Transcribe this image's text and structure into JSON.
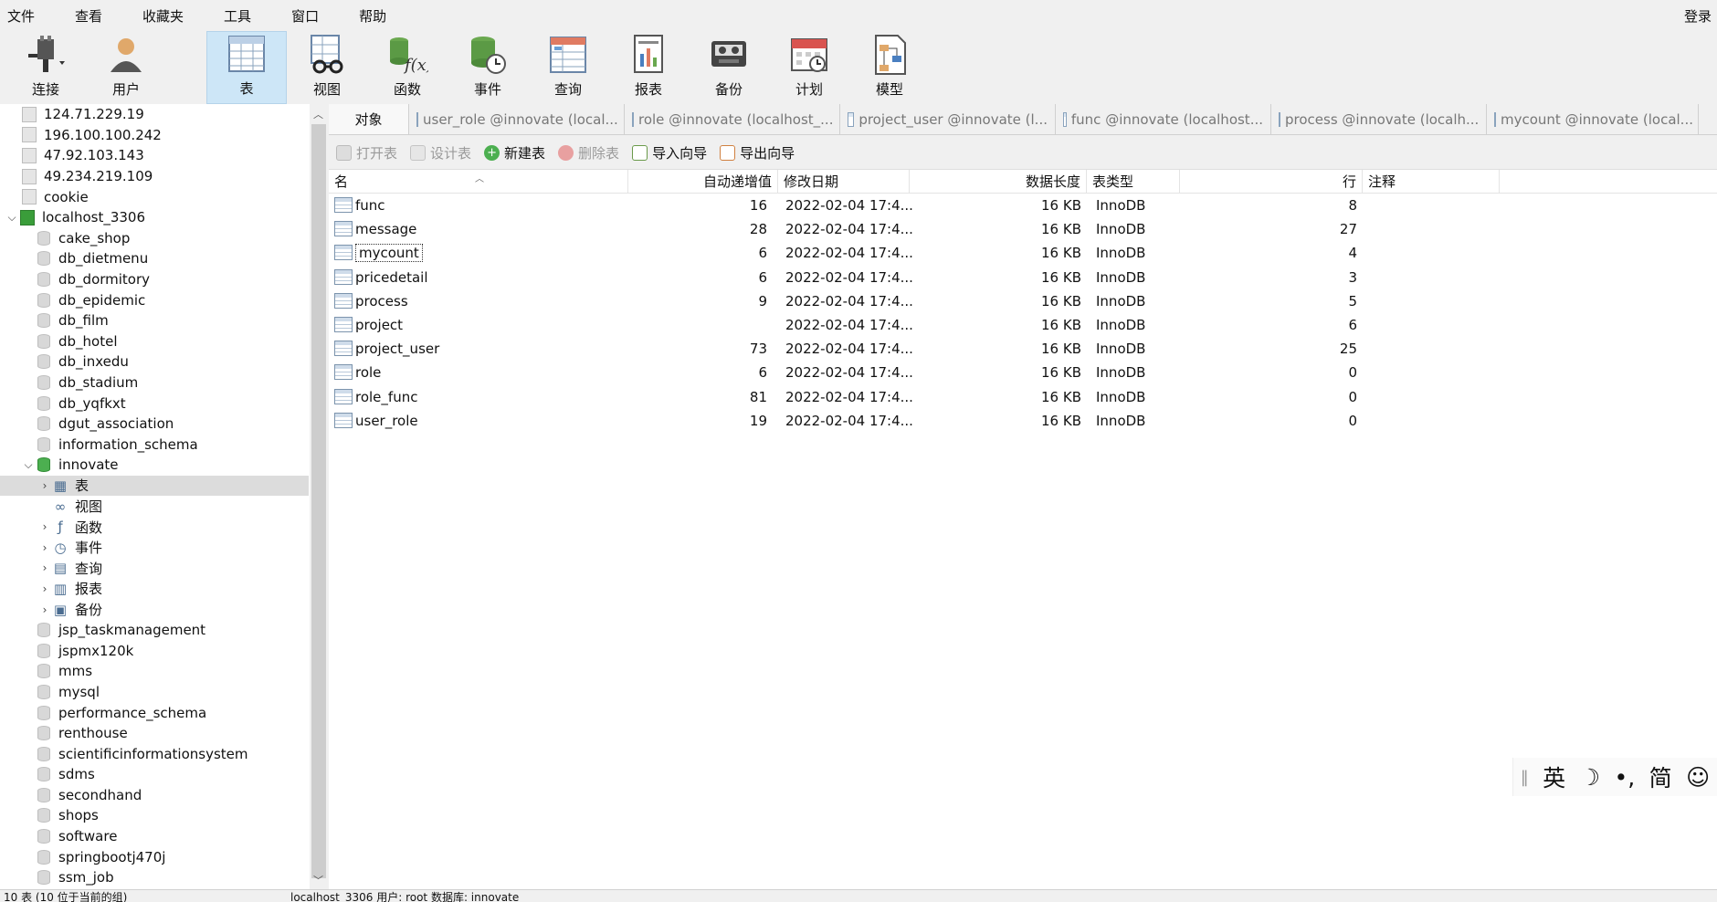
{
  "menu": {
    "items": [
      "文件",
      "查看",
      "收藏夹",
      "工具",
      "窗口",
      "帮助"
    ],
    "login": "登录"
  },
  "toolbar": {
    "items": [
      {
        "label": "连接",
        "icon": "plug-icon"
      },
      {
        "label": "用户",
        "icon": "user-icon"
      },
      {
        "label": "表",
        "icon": "table-icon"
      },
      {
        "label": "视图",
        "icon": "view-glasses-icon"
      },
      {
        "label": "函数",
        "icon": "function-icon"
      },
      {
        "label": "事件",
        "icon": "event-clock-icon"
      },
      {
        "label": "查询",
        "icon": "query-icon"
      },
      {
        "label": "报表",
        "icon": "report-icon"
      },
      {
        "label": "备份",
        "icon": "backup-icon"
      },
      {
        "label": "计划",
        "icon": "calendar-icon"
      },
      {
        "label": "模型",
        "icon": "model-icon"
      }
    ]
  },
  "tree": {
    "nodes": [
      {
        "label": "124.71.229.19",
        "level": 0,
        "type": "conn"
      },
      {
        "label": "196.100.100.242",
        "level": 0,
        "type": "conn"
      },
      {
        "label": "47.92.103.143",
        "level": 0,
        "type": "conn"
      },
      {
        "label": "49.234.219.109",
        "level": 0,
        "type": "conn"
      },
      {
        "label": "cookie",
        "level": 0,
        "type": "conn"
      },
      {
        "label": "localhost_3306",
        "level": 0,
        "type": "conn-on",
        "arrow": "down"
      },
      {
        "label": "cake_shop",
        "level": 1,
        "type": "db"
      },
      {
        "label": "db_dietmenu",
        "level": 1,
        "type": "db"
      },
      {
        "label": "db_dormitory",
        "level": 1,
        "type": "db"
      },
      {
        "label": "db_epidemic",
        "level": 1,
        "type": "db"
      },
      {
        "label": "db_film",
        "level": 1,
        "type": "db"
      },
      {
        "label": "db_hotel",
        "level": 1,
        "type": "db"
      },
      {
        "label": "db_inxedu",
        "level": 1,
        "type": "db"
      },
      {
        "label": "db_stadium",
        "level": 1,
        "type": "db"
      },
      {
        "label": "db_yqfkxt",
        "level": 1,
        "type": "db"
      },
      {
        "label": "dgut_association",
        "level": 1,
        "type": "db"
      },
      {
        "label": "information_schema",
        "level": 1,
        "type": "db"
      },
      {
        "label": "innovate",
        "level": 1,
        "type": "db-on",
        "arrow": "down"
      },
      {
        "label": "表",
        "level": 2,
        "type": "tables",
        "arrow": "right",
        "selected": true
      },
      {
        "label": "视图",
        "level": 2,
        "type": "views"
      },
      {
        "label": "函数",
        "level": 2,
        "type": "functions",
        "arrow": "right"
      },
      {
        "label": "事件",
        "level": 2,
        "type": "events",
        "arrow": "right"
      },
      {
        "label": "查询",
        "level": 2,
        "type": "queries",
        "arrow": "right"
      },
      {
        "label": "报表",
        "level": 2,
        "type": "reports",
        "arrow": "right"
      },
      {
        "label": "备份",
        "level": 2,
        "type": "backups",
        "arrow": "right"
      },
      {
        "label": "jsp_taskmanagement",
        "level": 1,
        "type": "db"
      },
      {
        "label": "jspmx120k",
        "level": 1,
        "type": "db"
      },
      {
        "label": "mms",
        "level": 1,
        "type": "db"
      },
      {
        "label": "mysql",
        "level": 1,
        "type": "db"
      },
      {
        "label": "performance_schema",
        "level": 1,
        "type": "db"
      },
      {
        "label": "renthouse",
        "level": 1,
        "type": "db"
      },
      {
        "label": "scientificinformationsystem",
        "level": 1,
        "type": "db"
      },
      {
        "label": "sdms",
        "level": 1,
        "type": "db"
      },
      {
        "label": "secondhand",
        "level": 1,
        "type": "db"
      },
      {
        "label": "shops",
        "level": 1,
        "type": "db"
      },
      {
        "label": "software",
        "level": 1,
        "type": "db"
      },
      {
        "label": "springbootj470j",
        "level": 1,
        "type": "db"
      },
      {
        "label": "ssm_job",
        "level": 1,
        "type": "db"
      }
    ]
  },
  "tabs": {
    "object_tab": "对象",
    "items": [
      "user_role @innovate (local...",
      "role @innovate (localhost_...",
      "project_user @innovate (l...",
      "func @innovate (localhost...",
      "process @innovate (localh...",
      "mycount @innovate (local..."
    ]
  },
  "objbar": {
    "open": "打开表",
    "design": "设计表",
    "new": "新建表",
    "delete": "删除表",
    "import": "导入向导",
    "export": "导出向导"
  },
  "table": {
    "headers": {
      "name": "名",
      "auto_inc": "自动递增值",
      "modified": "修改日期",
      "data_length": "数据长度",
      "engine": "表类型",
      "rows": "行",
      "comment": "注释"
    },
    "rows": [
      {
        "name": "func",
        "auto_inc": "16",
        "modified": "2022-02-04 17:4...",
        "data_length": "16 KB",
        "engine": "InnoDB",
        "rows": "8",
        "comment": ""
      },
      {
        "name": "message",
        "auto_inc": "28",
        "modified": "2022-02-04 17:4...",
        "data_length": "16 KB",
        "engine": "InnoDB",
        "rows": "27",
        "comment": ""
      },
      {
        "name": "mycount",
        "auto_inc": "6",
        "modified": "2022-02-04 17:4...",
        "data_length": "16 KB",
        "engine": "InnoDB",
        "rows": "4",
        "comment": "",
        "focused": true
      },
      {
        "name": "pricedetail",
        "auto_inc": "6",
        "modified": "2022-02-04 17:4...",
        "data_length": "16 KB",
        "engine": "InnoDB",
        "rows": "3",
        "comment": ""
      },
      {
        "name": "process",
        "auto_inc": "9",
        "modified": "2022-02-04 17:4...",
        "data_length": "16 KB",
        "engine": "InnoDB",
        "rows": "5",
        "comment": ""
      },
      {
        "name": "project",
        "auto_inc": "",
        "modified": "2022-02-04 17:4...",
        "data_length": "16 KB",
        "engine": "InnoDB",
        "rows": "6",
        "comment": ""
      },
      {
        "name": "project_user",
        "auto_inc": "73",
        "modified": "2022-02-04 17:4...",
        "data_length": "16 KB",
        "engine": "InnoDB",
        "rows": "25",
        "comment": ""
      },
      {
        "name": "role",
        "auto_inc": "6",
        "modified": "2022-02-04 17:4...",
        "data_length": "16 KB",
        "engine": "InnoDB",
        "rows": "0",
        "comment": ""
      },
      {
        "name": "role_func",
        "auto_inc": "81",
        "modified": "2022-02-04 17:4...",
        "data_length": "16 KB",
        "engine": "InnoDB",
        "rows": "0",
        "comment": ""
      },
      {
        "name": "user_role",
        "auto_inc": "19",
        "modified": "2022-02-04 17:4...",
        "data_length": "16 KB",
        "engine": "InnoDB",
        "rows": "0",
        "comment": ""
      }
    ]
  },
  "ime": {
    "lang": "英",
    "moon": "☽",
    "punct": "•,",
    "mode": "简",
    "emoji": "☺"
  },
  "status": {
    "left": "10 表 (10 位于当前的组)",
    "connection": "localhost_3306   用户: root   数据库: innovate"
  },
  "colors": {
    "accent": "#cde6f7",
    "selected_row": "#dcdcdc",
    "db_active": "#4caf50"
  }
}
